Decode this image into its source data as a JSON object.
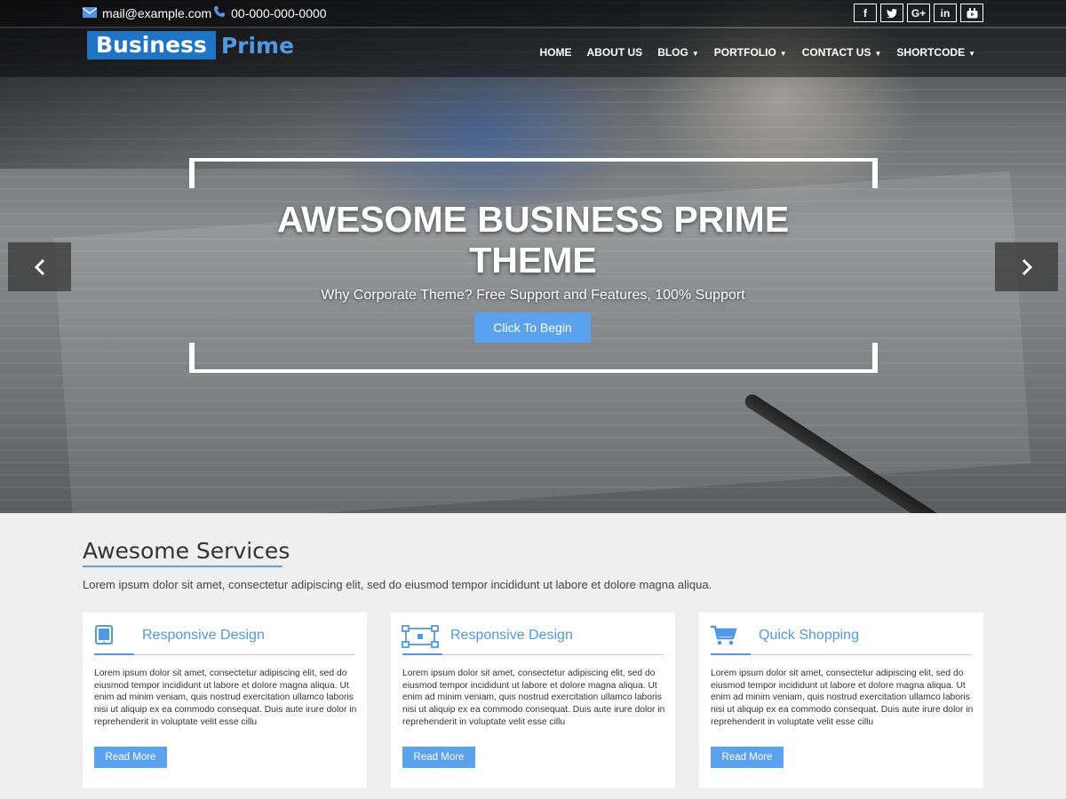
{
  "topbar": {
    "email": "mail@example.com",
    "email_icon": "envelope-icon",
    "phone": "00-000-000-0000",
    "phone_icon": "phone-icon",
    "socials": [
      {
        "name": "facebook-icon",
        "glyph": "f"
      },
      {
        "name": "twitter-icon",
        "glyph": "t"
      },
      {
        "name": "google-plus-icon",
        "glyph": "G+"
      },
      {
        "name": "linkedin-icon",
        "glyph": "in"
      },
      {
        "name": "youtube-icon",
        "glyph": "▶"
      }
    ]
  },
  "nav": {
    "logo_part1": "Business",
    "logo_part2": "Prime",
    "items": [
      {
        "label": "HOME"
      },
      {
        "label": "ABOUT US"
      },
      {
        "label": "BLOG"
      },
      {
        "label": "PORTFOLIO"
      },
      {
        "label": "CONTACT US"
      },
      {
        "label": "SHORTCODE"
      }
    ]
  },
  "hero": {
    "title": "AWESOME BUSINESS PRIME THEME",
    "subtitle": "Why Corporate Theme? Free Support and Features, 100% Support",
    "button": "Click To Begin",
    "prev_icon": "chevron-left-icon",
    "next_icon": "chevron-right-icon"
  },
  "services": {
    "title": "Awesome Services",
    "description": "Lorem ipsum dolor sit amet, consectetur adipiscing elit, sed do eiusmod tempor incididunt ut labore et dolore magna aliqua.",
    "cards": [
      {
        "icon": "tablet-icon",
        "title": "Responsive Design",
        "text": "Lorem ipsum dolor sit amet, consectetur adipiscing elit, sed do eiusmod tempor incididunt ut labore et dolore magna aliqua. Ut enim ad minim veniam, quis nostrud exercitation ullamco laboris nisi ut aliquip ex ea commodo consequat. Duis aute irure dolor in reprehenderit in voluptate velit esse cillu",
        "button": "Read More"
      },
      {
        "icon": "vector-square-icon",
        "title": "Responsive Design",
        "text": "Lorem ipsum dolor sit amet, consectetur adipiscing elit, sed do eiusmod tempor incididunt ut labore et dolore magna aliqua. Ut enim ad minim veniam, quis nostrud exercitation ullamco laboris nisi ut aliquip ex ea commodo consequat. Duis aute irure dolor in reprehenderit in voluptate velit esse cillu",
        "button": "Read More"
      },
      {
        "icon": "shopping-cart-icon",
        "title": "Quick Shopping",
        "text": "Lorem ipsum dolor sit amet, consectetur adipiscing elit, sed do eiusmod tempor incididunt ut labore et dolore magna aliqua. Ut enim ad minim veniam, quis nostrud exercitation ullamco laboris nisi ut aliquip ex ea commodo consequat. Duis aute irure dolor in reprehenderit in voluptate velit esse cillu",
        "button": "Read More"
      }
    ]
  },
  "colors": {
    "accent": "#5aa2f0",
    "logo_blue": "#1e74c6",
    "page_bg": "#efefef"
  }
}
